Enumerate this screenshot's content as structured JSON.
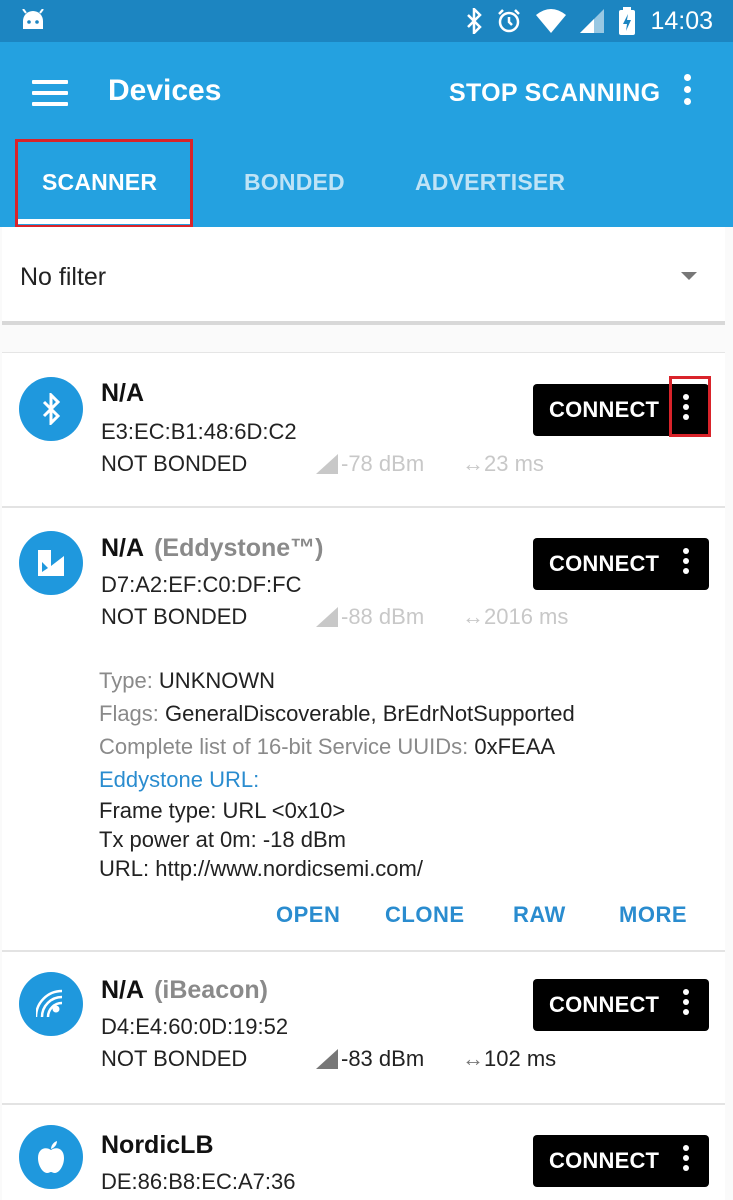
{
  "status_bar": {
    "time": "14:03",
    "icons": [
      "android-icon",
      "bluetooth-icon",
      "alarm-icon",
      "wifi-icon",
      "signal-icon",
      "battery-charging-icon"
    ]
  },
  "app_bar": {
    "title": "Devices",
    "action": "STOP SCANNING",
    "tabs": [
      {
        "label": "SCANNER",
        "active": true
      },
      {
        "label": "BONDED",
        "active": false
      },
      {
        "label": "ADVERTISER",
        "active": false
      }
    ]
  },
  "filter": {
    "selected": "No filter"
  },
  "devices": [
    {
      "name": "N/A",
      "kind": "",
      "address": "E3:EC:B1:48:6D:C2",
      "bond": "NOT BONDED",
      "rssi": "-78 dBm",
      "interval": "23 ms",
      "connect_label": "CONNECT",
      "icon": "bluetooth-icon"
    },
    {
      "name": "N/A",
      "kind": "(Eddystone™)",
      "address": "D7:A2:EF:C0:DF:FC",
      "bond": "NOT BONDED",
      "rssi": "-88 dBm",
      "interval": "2016 ms",
      "connect_label": "CONNECT",
      "icon": "eddystone-icon",
      "details": {
        "type_key": "Type: ",
        "type_val": "UNKNOWN",
        "flags_key": "Flags: ",
        "flags_val": "GeneralDiscoverable, BrEdrNotSupported",
        "uuids_key": "Complete list of 16-bit Service UUIDs: ",
        "uuids_val": "0xFEAA",
        "eddystone_header": "Eddystone URL:",
        "frame_type": "Frame type: URL <0x10>",
        "tx_power": "Tx power at 0m: -18 dBm",
        "url": "URL: http://www.nordicsemi.com/"
      },
      "actions": [
        "OPEN",
        "CLONE",
        "RAW",
        "MORE"
      ]
    },
    {
      "name": "N/A",
      "kind": "(iBeacon)",
      "address": "D4:E4:60:0D:19:52",
      "bond": "NOT BONDED",
      "rssi": "-83 dBm",
      "interval": "102 ms",
      "connect_label": "CONNECT",
      "icon": "ibeacon-icon"
    },
    {
      "name": "NordicLB",
      "kind": "",
      "address": "DE:86:B8:EC:A7:36",
      "bond": "",
      "rssi": "",
      "interval": "",
      "connect_label": "CONNECT",
      "icon": "apple-icon"
    }
  ],
  "colors": {
    "status_bar": "#1c85c1",
    "app_bar": "#24a1e0",
    "accent": "#2a8ccf",
    "highlight_box": "#d9232a"
  }
}
